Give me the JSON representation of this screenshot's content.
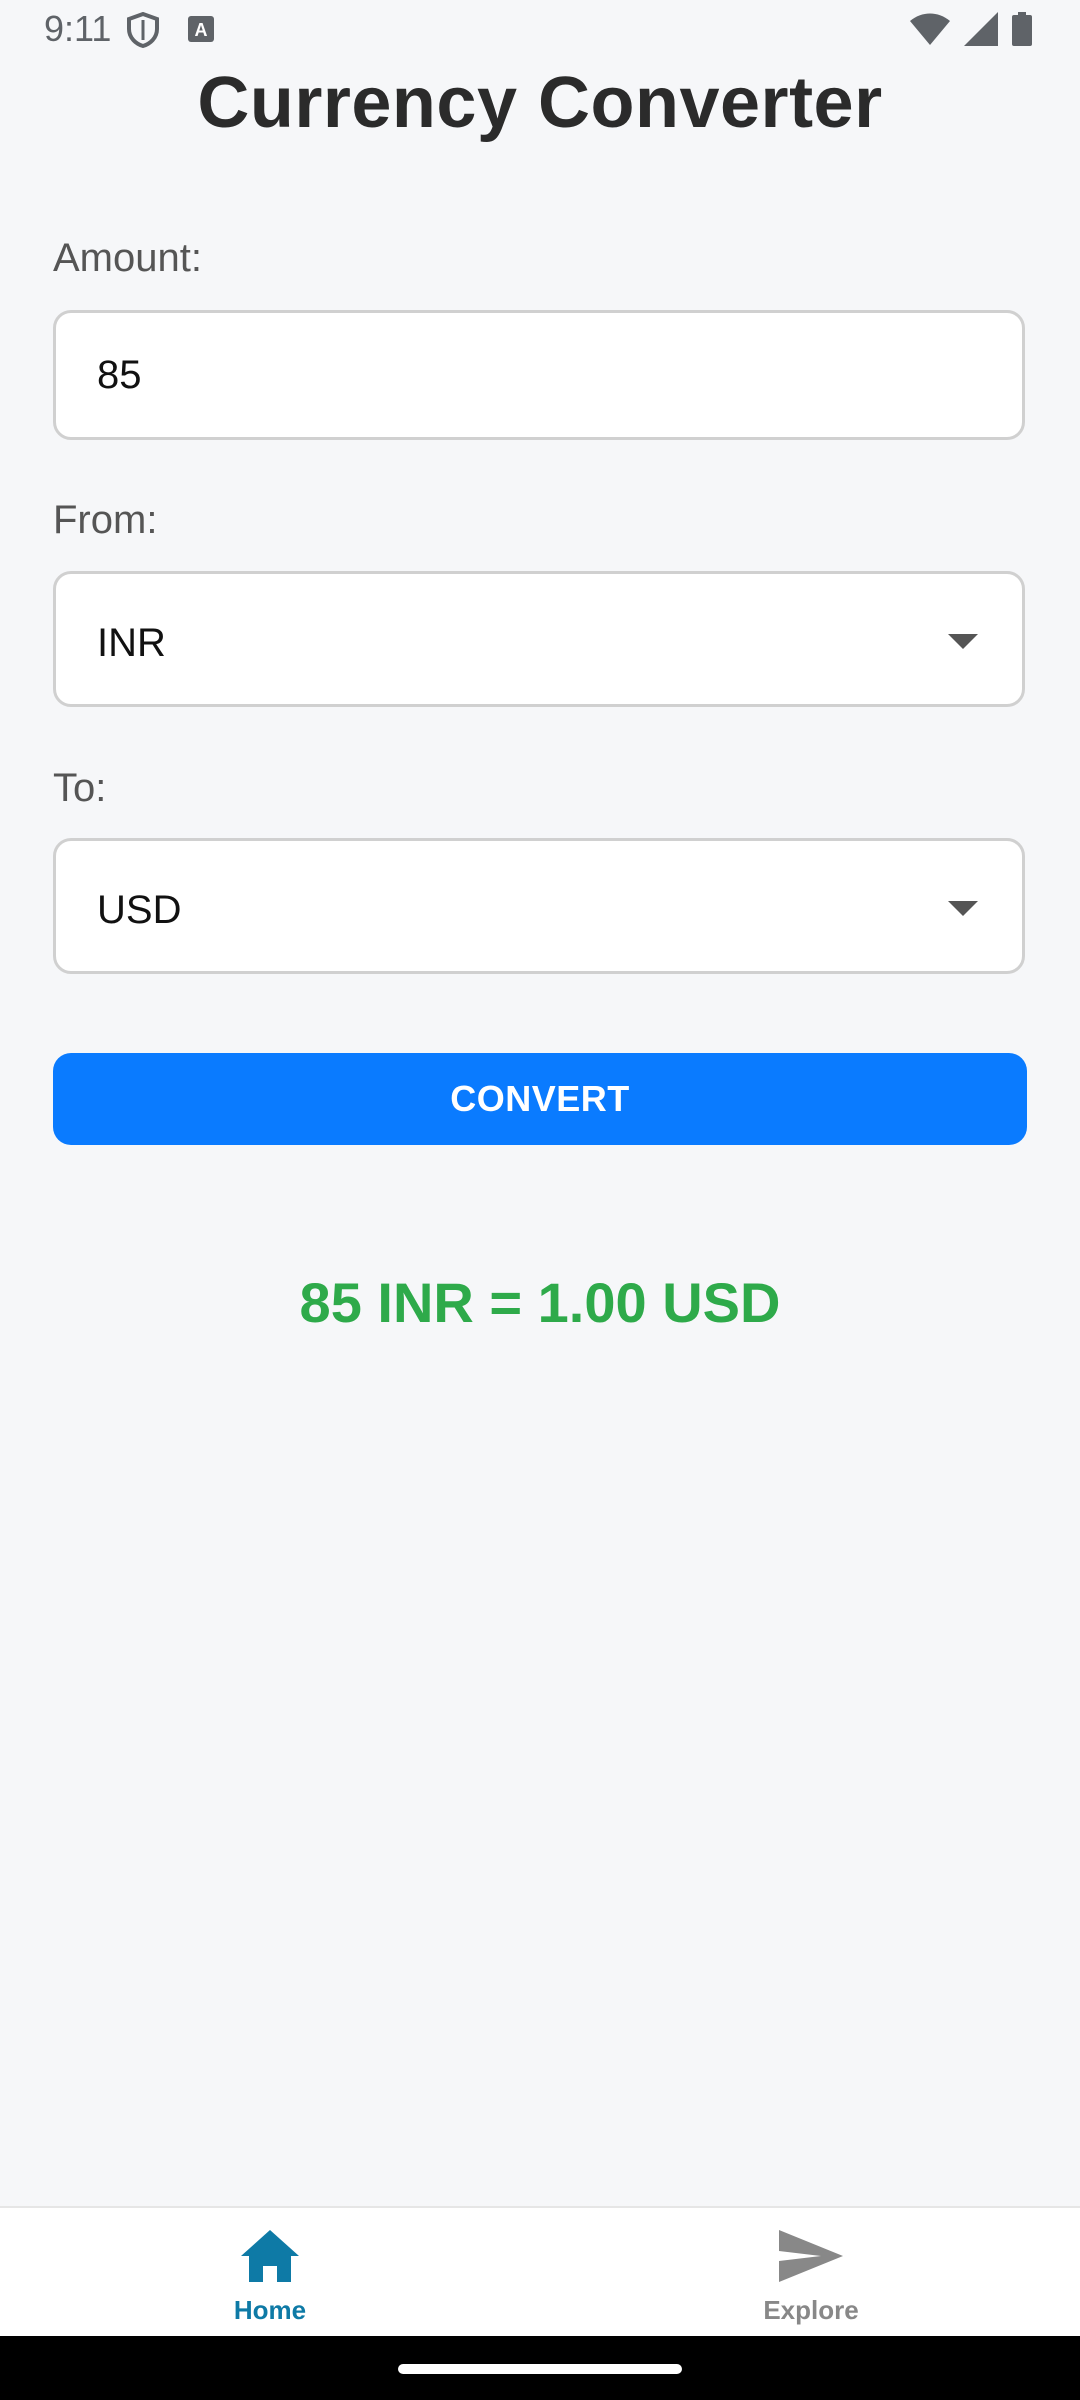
{
  "status_bar": {
    "time": "9:11",
    "left_icons": [
      "shield-icon",
      "font-a-icon"
    ],
    "right_icons": [
      "wifi-icon",
      "signal-icon",
      "battery-icon"
    ]
  },
  "title": "Currency Converter",
  "amount": {
    "label": "Amount:",
    "value": "85"
  },
  "from": {
    "label": "From:",
    "value": "INR"
  },
  "to": {
    "label": "To:",
    "value": "USD"
  },
  "convert_button": {
    "label": "CONVERT"
  },
  "result": {
    "text": "85 INR = 1.00 USD",
    "color": "#2eaa4a"
  },
  "bottom_nav": {
    "items": [
      {
        "label": "Home",
        "icon": "home-icon",
        "active": true,
        "color": "#0e7aa6"
      },
      {
        "label": "Explore",
        "icon": "send-icon",
        "active": false,
        "color": "#888888"
      }
    ]
  },
  "colors": {
    "accent": "#0a7bff",
    "background": "#f6f7f9"
  }
}
